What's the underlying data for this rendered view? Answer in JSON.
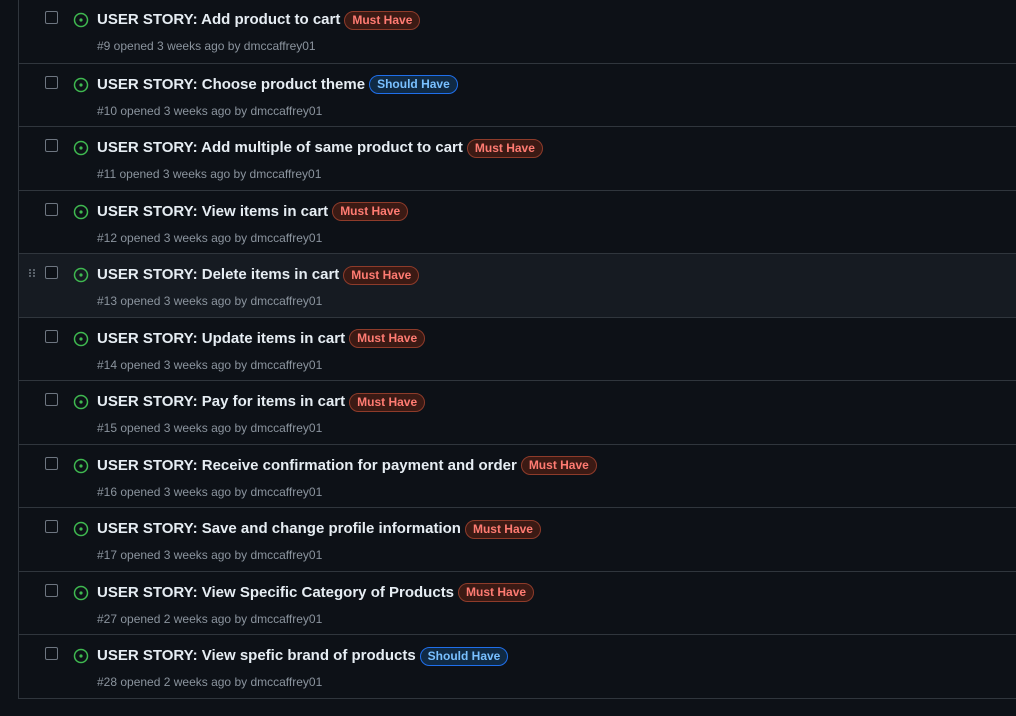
{
  "colors": {
    "open_icon": "#3fb950",
    "must_have": "#ff7b72",
    "should_have": "#79c0ff",
    "background": "#0d1117",
    "border": "#30363d"
  },
  "icons": {
    "status": "issue-opened-icon",
    "drag": "drag-handle-icon"
  },
  "issues": [
    {
      "title": "USER STORY: Add product to cart",
      "label": "Must Have",
      "label_type": "must",
      "meta": "#9 opened 3 weeks ago by dmccaffrey01"
    },
    {
      "title": "USER STORY: Choose product theme",
      "label": "Should Have",
      "label_type": "should",
      "meta": "#10 opened 3 weeks ago by dmccaffrey01"
    },
    {
      "title": "USER STORY: Add multiple of same product to cart",
      "label": "Must Have",
      "label_type": "must",
      "meta": "#11 opened 3 weeks ago by dmccaffrey01"
    },
    {
      "title": "USER STORY: View items in cart",
      "label": "Must Have",
      "label_type": "must",
      "meta": "#12 opened 3 weeks ago by dmccaffrey01"
    },
    {
      "title": "USER STORY: Delete items in cart",
      "label": "Must Have",
      "label_type": "must",
      "meta": "#13 opened 3 weeks ago by dmccaffrey01",
      "hovered": true
    },
    {
      "title": "USER STORY: Update items in cart",
      "label": "Must Have",
      "label_type": "must",
      "meta": "#14 opened 3 weeks ago by dmccaffrey01"
    },
    {
      "title": "USER STORY: Pay for items in cart",
      "label": "Must Have",
      "label_type": "must",
      "meta": "#15 opened 3 weeks ago by dmccaffrey01"
    },
    {
      "title": "USER STORY: Receive confirmation for payment and order",
      "label": "Must Have",
      "label_type": "must",
      "meta": "#16 opened 3 weeks ago by dmccaffrey01"
    },
    {
      "title": "USER STORY: Save and change profile information",
      "label": "Must Have",
      "label_type": "must",
      "meta": "#17 opened 3 weeks ago by dmccaffrey01"
    },
    {
      "title": "USER STORY: View Specific Category of Products",
      "label": "Must Have",
      "label_type": "must",
      "meta": "#27 opened 2 weeks ago by dmccaffrey01"
    },
    {
      "title": "USER STORY: View spefic brand of products",
      "label": "Should Have",
      "label_type": "should",
      "meta": "#28 opened 2 weeks ago by dmccaffrey01"
    }
  ]
}
